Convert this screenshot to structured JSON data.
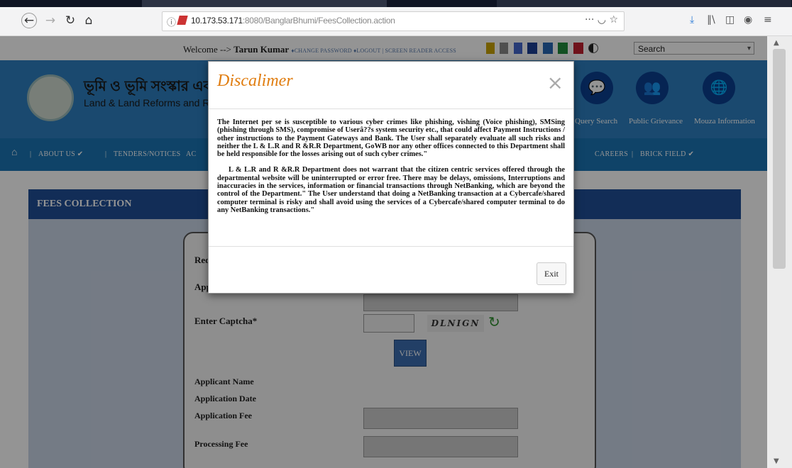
{
  "browser": {
    "url_host": "10.173.53.171",
    "url_rest": ":8080/BanglarBhumi/FeesCollection.action",
    "search_placeholder": "Search",
    "icons": [
      "back-icon",
      "forward-icon",
      "reload-icon",
      "home-icon",
      "info-icon",
      "insecure-lock-icon",
      "more-icon",
      "pocket-icon",
      "star-icon",
      "download-icon",
      "library-icon",
      "sidebar-icon",
      "extension-icon",
      "menu-icon"
    ]
  },
  "topbar": {
    "welcome_prefix": "Welcome --> ",
    "user_name": "Tarun Kumar",
    "links": "♦CHANGE PASSWORD ♦LOGOUT | SCREEN READER ACCESS",
    "swatch_colors": [
      "#1c3f95",
      "#2767b3",
      "#1f8a3c",
      "#c01f2f"
    ],
    "search_label": "Search"
  },
  "header": {
    "brand_bengali": "ভূমি ও ভূমি সংস্কার এবং উদ্বা",
    "brand_english": "Land & Land Reforms and Refugee Re",
    "quick_links": [
      {
        "label": "Query Search",
        "icon": "chat-icon"
      },
      {
        "label": "Public Grievance",
        "icon": "people-icon"
      },
      {
        "label": "Mouza Information",
        "icon": "globe-icon"
      }
    ]
  },
  "navbar": {
    "items": [
      "ABOUT US ✔",
      "|",
      "TENDERS/NOTICES",
      "|",
      "AC",
      "CAREERS",
      "|",
      "BRICK FIELD ✔"
    ]
  },
  "panel": {
    "title": "FEES COLLECTION",
    "labels": {
      "req": "Req",
      "app": "App",
      "captcha": "Enter Captcha*",
      "applicant_name": "Applicant Name",
      "application_date": "Application Date",
      "application_fee": "Application Fee",
      "processing_fee": "Processing Fee"
    },
    "captcha_text": "DLNIGN",
    "view_button": "VIEW"
  },
  "modal": {
    "title": "Discalimer",
    "close": "×",
    "para1": "The Internet per se is susceptible to various cyber crimes like phishing, vishing (Voice phishing), SMSing (phishing through SMS), compromise of Userâ??s system security etc., that could affect Payment Instructions / other instructions to the Payment Gateways and Bank. The User shall separately evaluate all such risks and neither the L & L.R and R &R.R Department, GoWB nor any other offices connected to this Department shall be held responsible for the losses arising out of such cyber crimes.\"",
    "para2": "L & L.R and R &R.R Department does not warrant that the citizen centric services offered through the departmental website will be uninterrupted or error free. There may be delays, omissions, Interruptions and inaccuracies in the services, information or financial transactions through NetBanking, which are beyond the control of the Department.\" The User understand that doing a NetBanking transaction at a Cybercafe/shared computer terminal is risky and shall avoid using the services of a Cybercafe/shared computer terminal to do any NetBanking transactions.\"",
    "exit_button": "Exit"
  }
}
